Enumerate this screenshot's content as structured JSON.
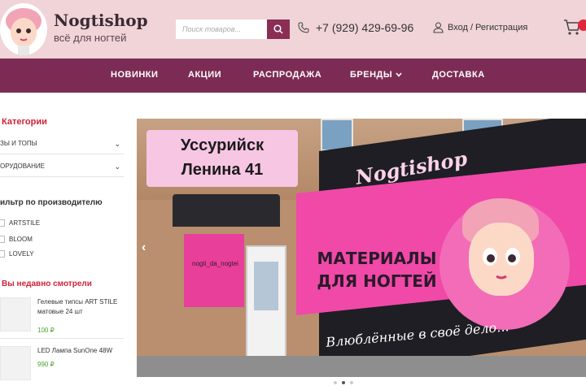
{
  "header": {
    "brand": "Nogtishop",
    "tagline": "всё для ногтей",
    "search_placeholder": "Поиск товаров...",
    "phone": "+7 (929) 429-69-96",
    "login": "Вход / Регистрация"
  },
  "nav": {
    "items": [
      "НОВИНКИ",
      "АКЦИИ",
      "РАСПРОДАЖА",
      "БРЕНДЫ",
      "ДОСТАВКА"
    ]
  },
  "sidebar": {
    "categories_title": "Категории",
    "categories": [
      "ЗЫ И ТОПЫ",
      "ОРУДОВАНИЕ"
    ],
    "filter_title": "ильтр по производителю",
    "brands": [
      "ARTSTILE",
      "BLOOM",
      "LOVELY"
    ],
    "recent_title": "Вы недавно смотрели",
    "recent": [
      {
        "name": "Гелевые типсы ART STILE матовые 24 шт",
        "price": "100 ₽"
      },
      {
        "name": "LED Лампа SunOne 48W",
        "price": "990 ₽"
      }
    ]
  },
  "banner": {
    "address_line1": "Уссурийск",
    "address_line2": "Ленина 41",
    "neon_logo": "Nogtishop",
    "sign_line1": "МАТЕРИАЛЫ",
    "sign_line2": "ДЛЯ НОГТЕЙ",
    "slogan": "Влюблённые в своё дело...",
    "handle": "nogti_da_nogtei",
    "slide_count": 3,
    "active_slide": 2
  },
  "colors": {
    "header_bg": "#f0d4d8",
    "nav_bg": "#7c2c54",
    "accent_red": "#d0213a",
    "price_green": "#4ca32d"
  }
}
